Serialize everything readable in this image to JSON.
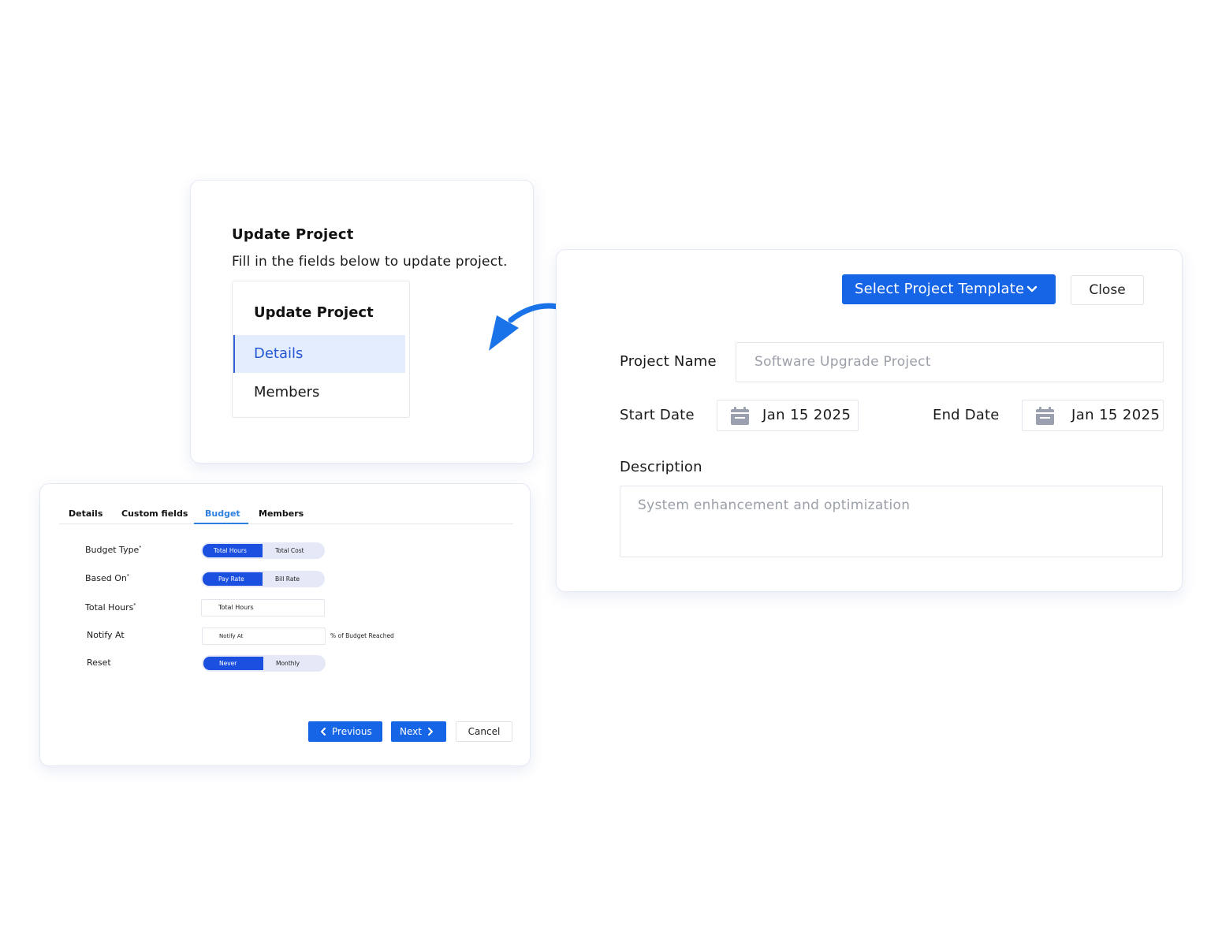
{
  "update_card": {
    "title": "Update Project",
    "subtitle": "Fill in the fields below to update project.",
    "menu": {
      "title": "Update Project",
      "items": [
        {
          "label": "Details",
          "active": true
        },
        {
          "label": "Members",
          "active": false
        }
      ]
    }
  },
  "arrow": {
    "color": "#1a73e8",
    "icon": "curved-arrow-left-icon"
  },
  "form_card": {
    "template_button": "Select Project Template",
    "close_button": "Close",
    "project_name_label": "Project Name",
    "project_name_placeholder": "Software Upgrade Project",
    "start_date_label": "Start Date",
    "start_date_value": "Jan 15 2025",
    "end_date_label": "End Date",
    "end_date_value": "Jan 15 2025",
    "description_label": "Description",
    "description_placeholder": "System enhancement and optimization"
  },
  "budget_card": {
    "tabs": [
      {
        "label": "Details",
        "active": false
      },
      {
        "label": "Custom fields",
        "active": false
      },
      {
        "label": "Budget",
        "active": true
      },
      {
        "label": "Members",
        "active": false
      }
    ],
    "fields": {
      "budget_type": {
        "label": "Budget Type",
        "required_mark": "*",
        "options": [
          "Total Hours",
          "Total Cost"
        ],
        "selected": "Total Hours"
      },
      "based_on": {
        "label": "Based On",
        "required_mark": "*",
        "options": [
          "Pay Rate",
          "Bill Rate"
        ],
        "selected": "Pay Rate"
      },
      "total_hours": {
        "label": "Total Hours",
        "required_mark": "*",
        "placeholder": "Total Hours"
      },
      "notify_at": {
        "label": "Notify At",
        "placeholder": "Notify At",
        "suffix": "% of Budget Reached"
      },
      "reset": {
        "label": "Reset",
        "options": [
          "Never",
          "Monthly"
        ],
        "selected": "Never"
      }
    },
    "buttons": {
      "previous": "Previous",
      "next": "Next",
      "cancel": "Cancel"
    }
  },
  "colors": {
    "primary": "#1665e6",
    "toggle_on": "#1b4fe0",
    "tab_active": "#2d7fe0",
    "menu_active_bg": "#e4edfd"
  }
}
